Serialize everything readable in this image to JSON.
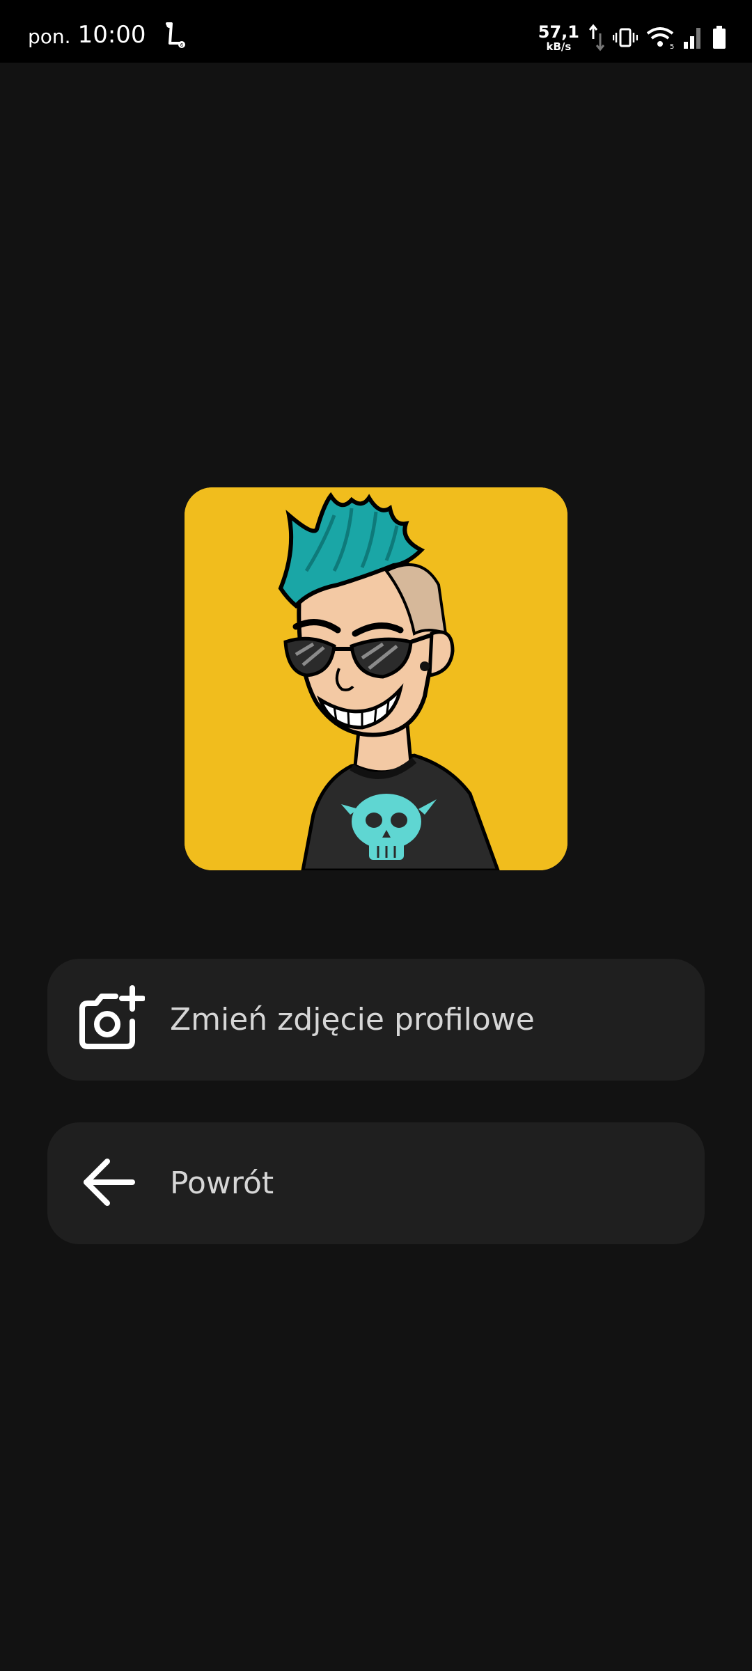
{
  "status_bar": {
    "day": "pon.",
    "time": "10:00",
    "net_speed_value": "57,1",
    "net_speed_unit": "kB/s",
    "icons": [
      "scooter-icon",
      "data-transfer-icon",
      "vibrate-icon",
      "wifi-icon",
      "signal-icon",
      "battery-icon"
    ]
  },
  "profile": {
    "avatar_icon": "cartoon-avatar-punk",
    "avatar_bg_color": "#f1bd1d"
  },
  "actions": {
    "change_photo_label": "Zmień zdjęcie profilowe",
    "change_photo_icon": "add-photo-camera-icon",
    "back_label": "Powrót",
    "back_icon": "arrow-left-icon"
  },
  "colors": {
    "background": "#121212",
    "button_bg": "#1f1f1f",
    "button_text": "#d6d6d6",
    "status_bar_bg": "#000000"
  }
}
